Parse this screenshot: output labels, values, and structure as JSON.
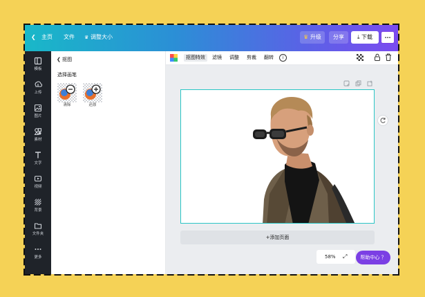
{
  "topbar": {
    "home": "主页",
    "file": "文件",
    "resize": "调整大小",
    "upgrade": "升级",
    "share": "分享",
    "download": "下载",
    "more": "···"
  },
  "sidebar": {
    "items": [
      {
        "label": "模板",
        "icon": "template-icon"
      },
      {
        "label": "上传",
        "icon": "upload-icon"
      },
      {
        "label": "图片",
        "icon": "image-icon"
      },
      {
        "label": "素材",
        "icon": "elements-icon"
      },
      {
        "label": "文字",
        "icon": "text-icon"
      },
      {
        "label": "视频",
        "icon": "video-icon"
      },
      {
        "label": "背景",
        "icon": "background-icon"
      },
      {
        "label": "文件夹",
        "icon": "folder-icon"
      },
      {
        "label": "更多",
        "icon": "more-icon"
      }
    ]
  },
  "panel": {
    "back_label": "抠图",
    "section_title": "选择画笔",
    "brushes": [
      {
        "label": "清除",
        "icon": "erase-brush-icon"
      },
      {
        "label": "还原",
        "icon": "restore-brush-icon"
      }
    ]
  },
  "toolbar": {
    "tabs": [
      "抠图特效",
      "滤镜",
      "调整",
      "剪裁",
      "翻转"
    ]
  },
  "canvas": {
    "add_page": "+添加页面",
    "zoom": "58%",
    "help": "帮助中心 ？"
  },
  "colors": {
    "accent": "#7b3fe4",
    "page_border": "#29c5c5",
    "background": "#f5d256"
  }
}
